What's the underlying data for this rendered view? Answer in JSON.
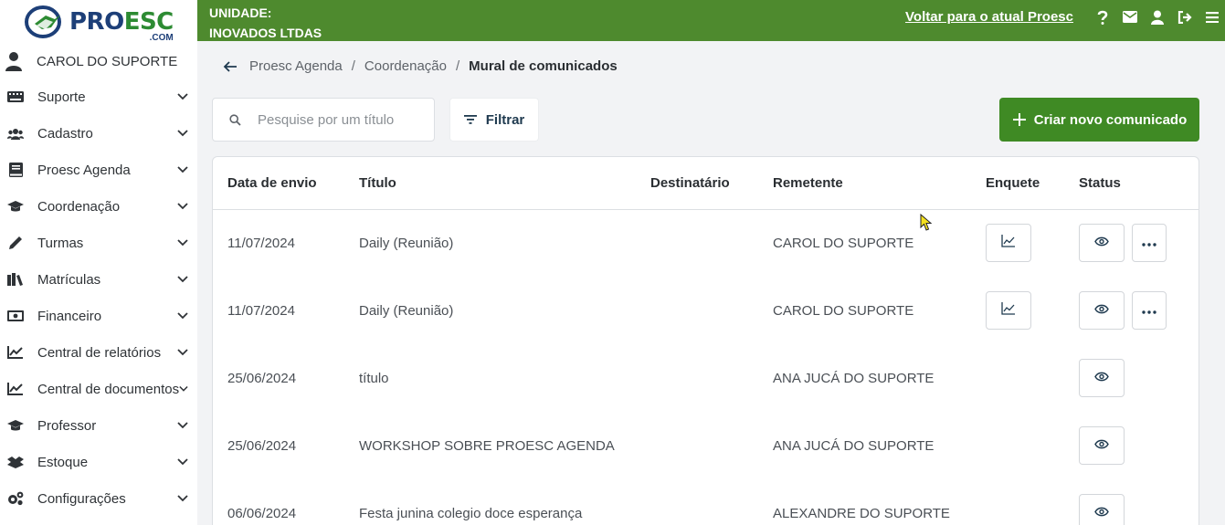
{
  "brand": {
    "logo_text_main": "PROESC",
    "logo_text_suffix": ".COM",
    "primary_color": "#4e8a2e",
    "navy": "#1d3f78"
  },
  "user": {
    "name": "CAROL DO SUPORTE"
  },
  "sidebar": {
    "items": [
      {
        "label": "Suporte",
        "icon": "keyboard-icon"
      },
      {
        "label": "Cadastro",
        "icon": "users-icon"
      },
      {
        "label": "Proesc Agenda",
        "icon": "book-icon"
      },
      {
        "label": "Coordenação",
        "icon": "graduation-cap-icon"
      },
      {
        "label": "Turmas",
        "icon": "pencil-icon"
      },
      {
        "label": "Matrículas",
        "icon": "books-icon"
      },
      {
        "label": "Financeiro",
        "icon": "money-icon"
      },
      {
        "label": "Central de relatórios",
        "icon": "line-chart-icon"
      },
      {
        "label": "Central de documentos",
        "icon": "line-chart-icon"
      },
      {
        "label": "Professor",
        "icon": "graduation-cap-icon"
      },
      {
        "label": "Estoque",
        "icon": "boxes-icon"
      },
      {
        "label": "Configurações",
        "icon": "gears-icon"
      }
    ]
  },
  "topbar": {
    "unit_label": "UNIDADE:",
    "unit_name": "INOVADOS LTDAS",
    "back_link": "Voltar para o atual Proesc",
    "icons": [
      "help-icon",
      "mail-icon",
      "user-icon",
      "logout-icon",
      "menu-icon"
    ]
  },
  "breadcrumb": {
    "items": [
      "Proesc Agenda",
      "Coordenação"
    ],
    "separator": "/",
    "current": "Mural de comunicados"
  },
  "search": {
    "placeholder": "Pesquise por um título",
    "value": ""
  },
  "filter": {
    "label": "Filtrar"
  },
  "create": {
    "label": "Criar novo comunicado"
  },
  "table": {
    "columns": [
      "Data de envio",
      "Título",
      "Destinatário",
      "Remetente",
      "Enquete",
      "Status"
    ],
    "rows": [
      {
        "date": "11/07/2024",
        "title": "Daily (Reunião)",
        "recipient": "",
        "sender": "CAROL DO SUPORTE",
        "has_poll": true,
        "has_more": true
      },
      {
        "date": "11/07/2024",
        "title": "Daily (Reunião)",
        "recipient": "",
        "sender": "CAROL DO SUPORTE",
        "has_poll": true,
        "has_more": true
      },
      {
        "date": "25/06/2024",
        "title": "título",
        "recipient": "",
        "sender": "ANA JUCÁ DO SUPORTE",
        "has_poll": false,
        "has_more": false
      },
      {
        "date": "25/06/2024",
        "title": "WORKSHOP SOBRE PROESC AGENDA",
        "recipient": "",
        "sender": "ANA JUCÁ DO SUPORTE",
        "has_poll": false,
        "has_more": false
      },
      {
        "date": "06/06/2024",
        "title": "Festa junina colegio doce esperança",
        "recipient": "",
        "sender": "ALEXANDRE DO SUPORTE",
        "has_poll": false,
        "has_more": false
      }
    ]
  }
}
